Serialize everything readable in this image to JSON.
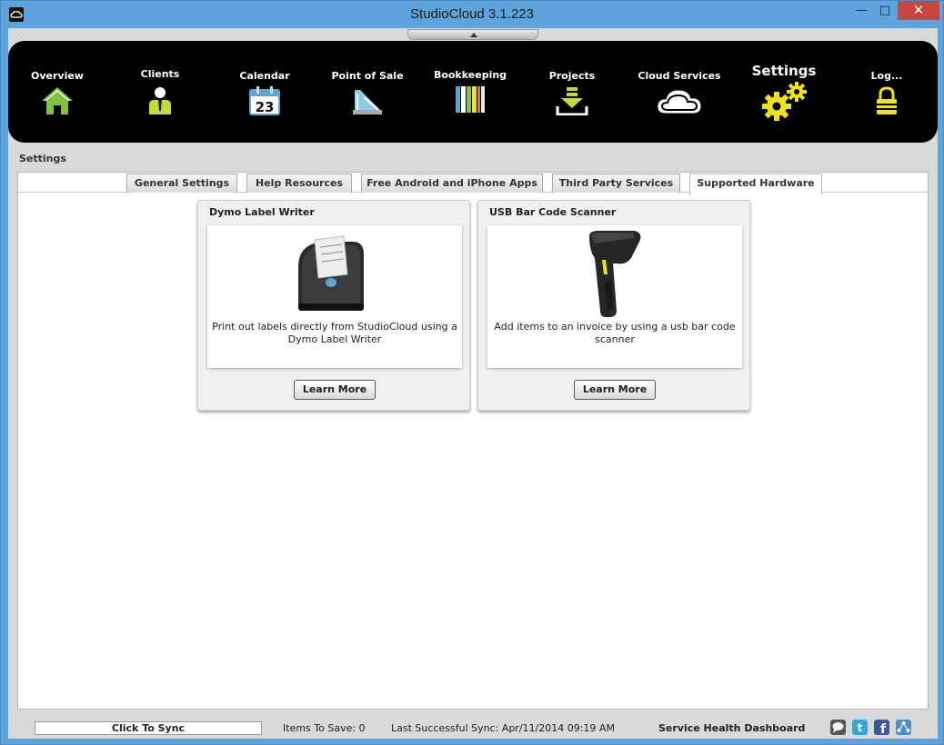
{
  "window": {
    "title": "StudioCloud 3.1.223",
    "minimize": "—",
    "maximize": "□",
    "close": "✕"
  },
  "nav": {
    "items": [
      {
        "label": "Overview",
        "icon": "home-icon"
      },
      {
        "label": "Clients",
        "icon": "client-person-icon"
      },
      {
        "label": "Calendar",
        "icon": "calendar-icon",
        "day": "23"
      },
      {
        "label": "Point of Sale",
        "icon": "point-of-sale-icon"
      },
      {
        "label": "Bookkeeping",
        "icon": "books-icon"
      },
      {
        "label": "Projects",
        "icon": "download-tray-icon"
      },
      {
        "label": "Cloud Services",
        "icon": "cloud-icon"
      },
      {
        "label": "Settings",
        "icon": "gears-icon",
        "active": true
      },
      {
        "label": "Log...",
        "icon": "lock-icon"
      }
    ]
  },
  "breadcrumb": "Settings",
  "tabs": [
    {
      "label": "General Settings"
    },
    {
      "label": "Help Resources"
    },
    {
      "label": "Free Android and iPhone Apps"
    },
    {
      "label": "Third Party Services"
    },
    {
      "label": "Supported Hardware",
      "active": true
    }
  ],
  "cards": [
    {
      "title": "Dymo Label Writer",
      "description": "Print out labels directly from StudioCloud using a Dymo Label Writer",
      "button": "Learn More",
      "image": "label-printer-image"
    },
    {
      "title": "USB Bar Code Scanner",
      "description": "Add items to an invoice by using a usb bar code scanner",
      "button": "Learn More",
      "image": "barcode-scanner-image"
    }
  ],
  "status": {
    "sync_button": "Click To Sync",
    "items_to_save": "Items To Save: 0",
    "last_sync": "Last Successful Sync: Apr/11/2014 09:19 AM",
    "dashboard_link": "Service Health Dashboard",
    "social_icons": [
      "chat-icon",
      "twitter-icon",
      "facebook-icon",
      "network-icon"
    ]
  },
  "colors": {
    "accent_green": "#7ec242",
    "accent_yellow": "#f2e21c",
    "navbar_bg": "#000000",
    "window_frame": "#5ea3db"
  }
}
